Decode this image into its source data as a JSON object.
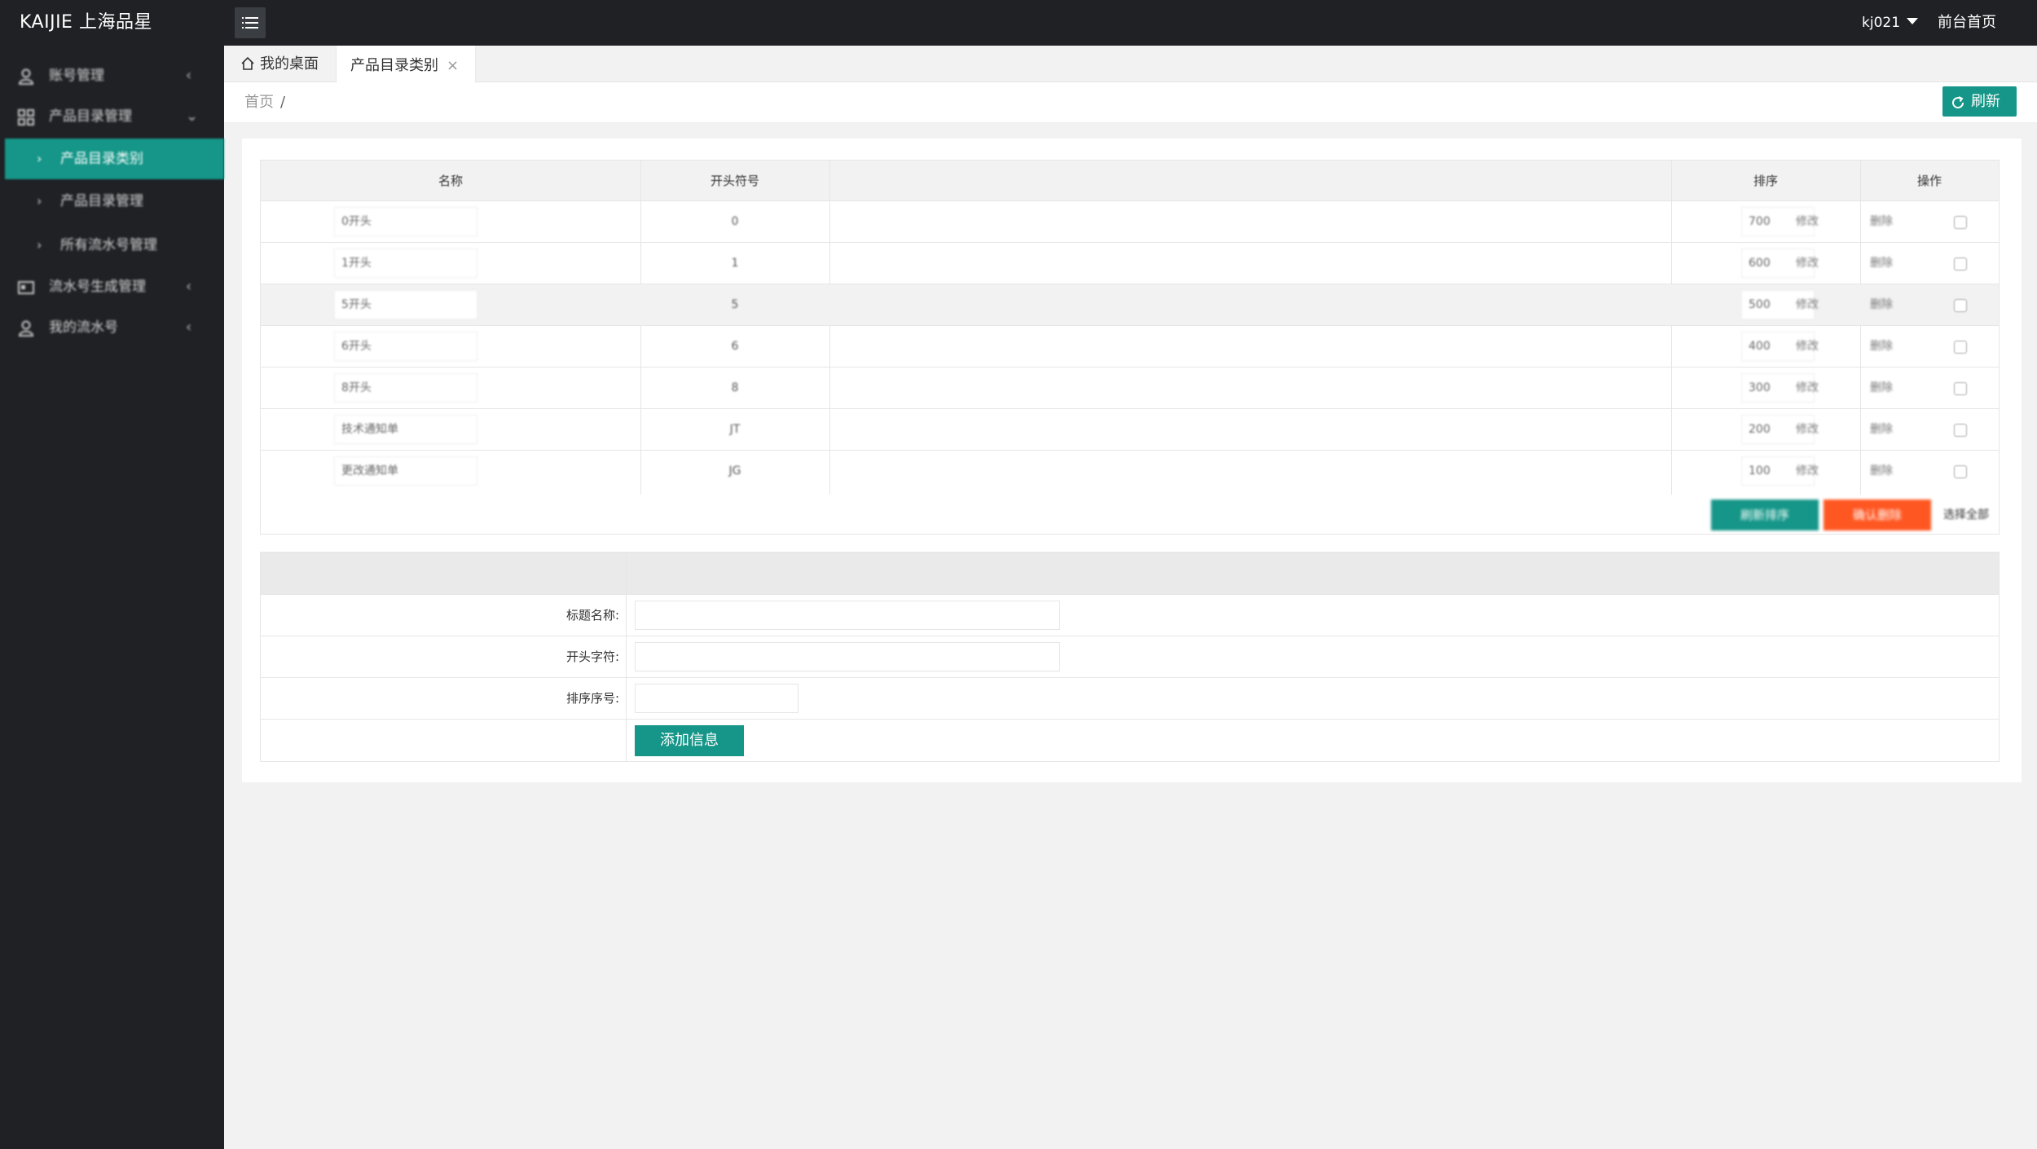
{
  "app": {
    "brand": "KAIJIE 上海品星"
  },
  "topbar": {
    "user": "kj021",
    "front_link": "前台首页"
  },
  "sidebar": {
    "items": [
      {
        "label": "账号管理",
        "icon": "user-icon"
      },
      {
        "label": "产品目录管理",
        "icon": "grid-icon",
        "expanded": true,
        "children": [
          {
            "label": "产品目录类别",
            "active": true
          },
          {
            "label": "产品目录管理"
          },
          {
            "label": "所有流水号管理"
          }
        ]
      },
      {
        "label": "流水号生成管理",
        "icon": "card-icon"
      },
      {
        "label": "我的流水号",
        "icon": "user-icon"
      }
    ]
  },
  "tabs": [
    {
      "label": "我的桌面",
      "icon": "home-icon"
    },
    {
      "label": "产品目录类别",
      "active": true
    }
  ],
  "breadcrumb": {
    "home": "首页",
    "separator": "/"
  },
  "refresh_label": "刷新",
  "list": {
    "headers": {
      "name": "名称",
      "prefix": "开头符号",
      "sort": "排序",
      "ops": "操作"
    },
    "rows": [
      {
        "name": "0开头",
        "prefix": "0",
        "sort": "700",
        "edit": "修改",
        "delete": "删除"
      },
      {
        "name": "1开头",
        "prefix": "1",
        "sort": "600",
        "edit": "修改",
        "delete": "删除"
      },
      {
        "name": "5开头",
        "prefix": "5",
        "sort": "500",
        "edit": "修改",
        "delete": "删除"
      },
      {
        "name": "6开头",
        "prefix": "6",
        "sort": "400",
        "edit": "修改",
        "delete": "删除"
      },
      {
        "name": "8开头",
        "prefix": "8",
        "sort": "300",
        "edit": "修改",
        "delete": "删除"
      },
      {
        "name": "技术通知单",
        "prefix": "JT",
        "sort": "200",
        "edit": "修改",
        "delete": "删除"
      },
      {
        "name": "更改通知单",
        "prefix": "JG",
        "sort": "100",
        "edit": "修改",
        "delete": "删除"
      }
    ],
    "actions": {
      "update_sort": "刷新排序",
      "confirm_delete": "确认删除",
      "select_all": "选择全部"
    }
  },
  "form": {
    "title_label": "标题名称:",
    "prefix_label": "开头字符:",
    "sort_label": "排序序号:",
    "title_value": "",
    "prefix_value": "",
    "sort_value": "",
    "submit": "添加信息"
  },
  "colors": {
    "accent": "#159688",
    "danger": "#ff5722",
    "sidebar": "#1f2125"
  }
}
